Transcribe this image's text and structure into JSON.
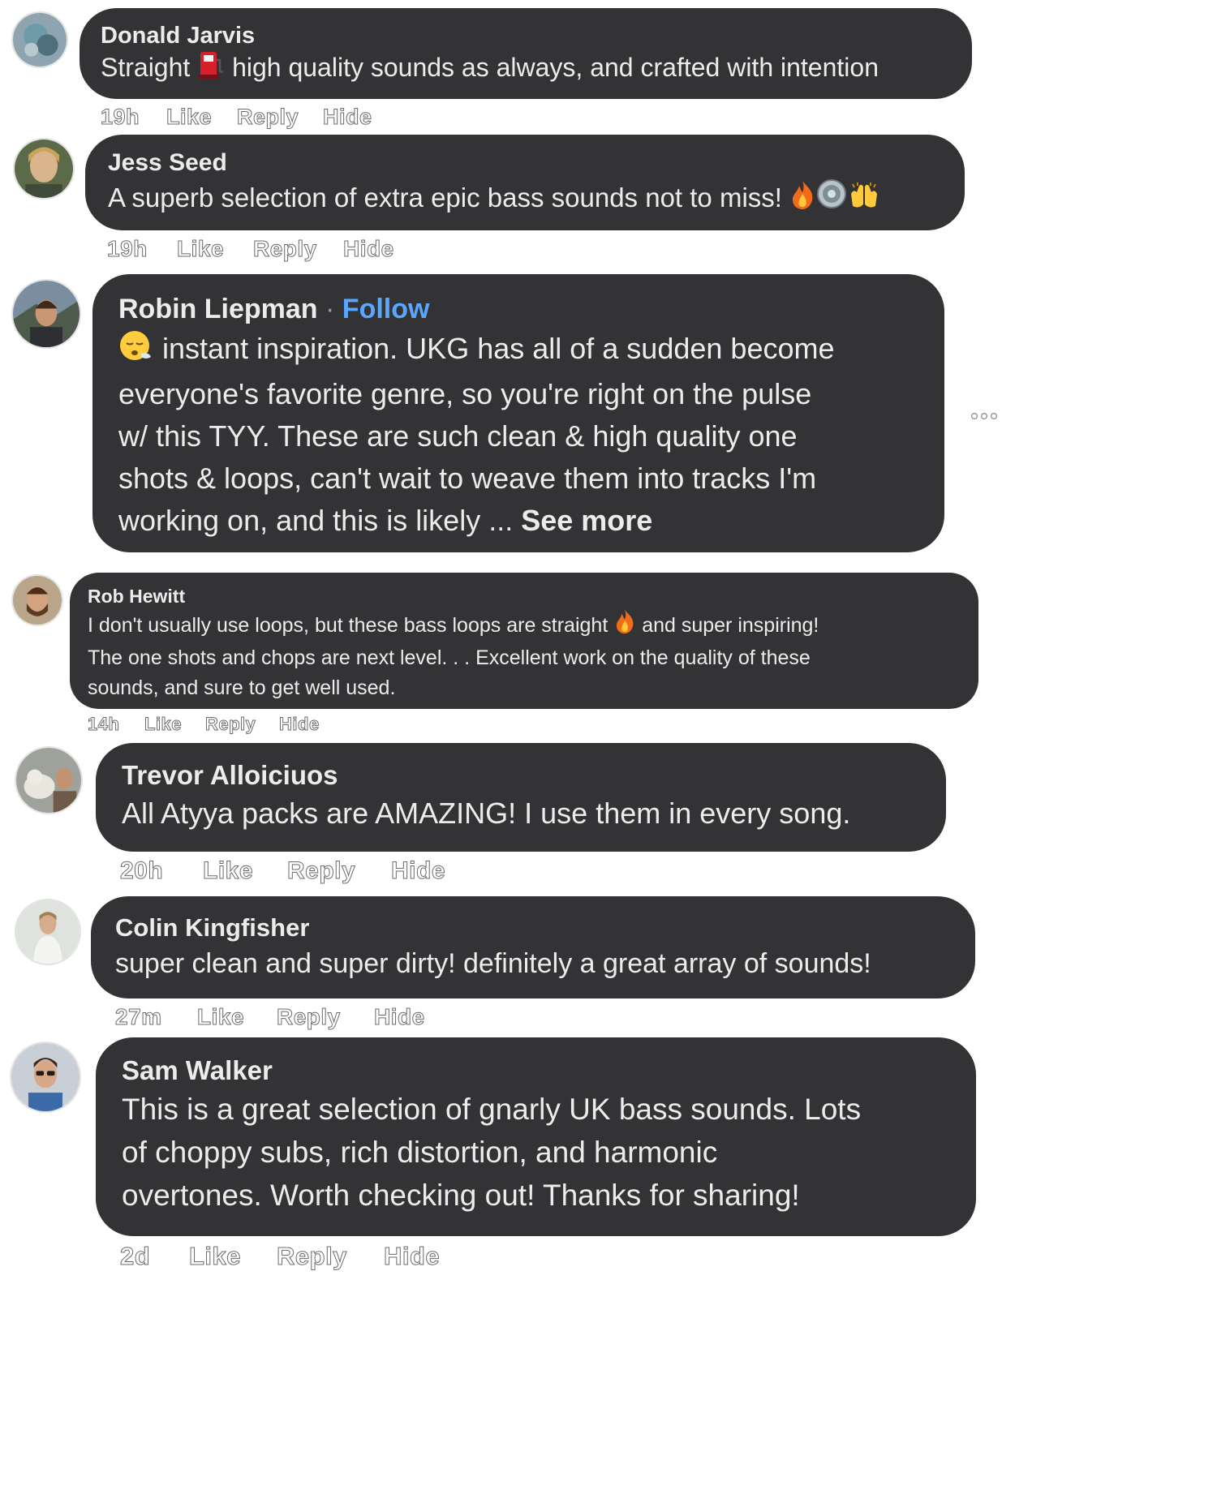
{
  "comments": [
    {
      "name": "Donald Jarvis",
      "text_parts": [
        "Straight",
        "high quality sounds as always, and crafted with intention"
      ],
      "emojis": [
        "fuel-pump"
      ],
      "time": "19h",
      "like": "Like",
      "reply": "Reply",
      "hide": "Hide"
    },
    {
      "name": "Jess Seed",
      "text": "A superb selection of extra epic bass sounds not to miss!",
      "emojis": [
        "fire",
        "speaker",
        "raised-hands"
      ],
      "time": "19h",
      "like": "Like",
      "reply": "Reply",
      "hide": "Hide"
    },
    {
      "name": "Robin Liepman",
      "separator": "·",
      "follow": "Follow",
      "emojis": [
        "face-exhaling"
      ],
      "lines": [
        "instant inspiration. UKG has all of a sudden become",
        "everyone's favorite genre, so you're right on the pulse",
        "w/ this TYY. These are such clean & high quality one",
        "shots & loops, can't wait to weave them into tracks I'm",
        "working on, and this is likely ..."
      ],
      "see_more": "See more"
    },
    {
      "name": "Rob Hewitt",
      "lines": [
        "I don't usually use loops, but these bass loops are straight",
        "and super inspiring!",
        "The one shots and chops are next level. . . Excellent work on the quality of these",
        "sounds, and sure to get well used."
      ],
      "emojis": [
        "fire"
      ],
      "time": "14h",
      "like": "Like",
      "reply": "Reply",
      "hide": "Hide"
    },
    {
      "name": "Trevor Alloiciuos",
      "text": "All Atyya packs are AMAZING! I use them in every song.",
      "time": "20h",
      "like": "Like",
      "reply": "Reply",
      "hide": "Hide"
    },
    {
      "name": "Colin Kingfisher",
      "text": "super clean and super dirty! definitely a great array of sounds!",
      "time": "27m",
      "like": "Like",
      "reply": "Reply",
      "hide": "Hide"
    },
    {
      "name": "Sam Walker",
      "lines": [
        "This is a great selection of gnarly UK bass sounds. Lots",
        "of choppy subs, rich distortion, and harmonic",
        "overtones. Worth checking out! Thanks for sharing!"
      ],
      "time": "2d",
      "like": "Like",
      "reply": "Reply",
      "hide": "Hide"
    }
  ],
  "more_icon": "more-options-icon",
  "colors": {
    "bubble": "#333336",
    "text": "#ececec",
    "follow": "#5aa7ff"
  }
}
